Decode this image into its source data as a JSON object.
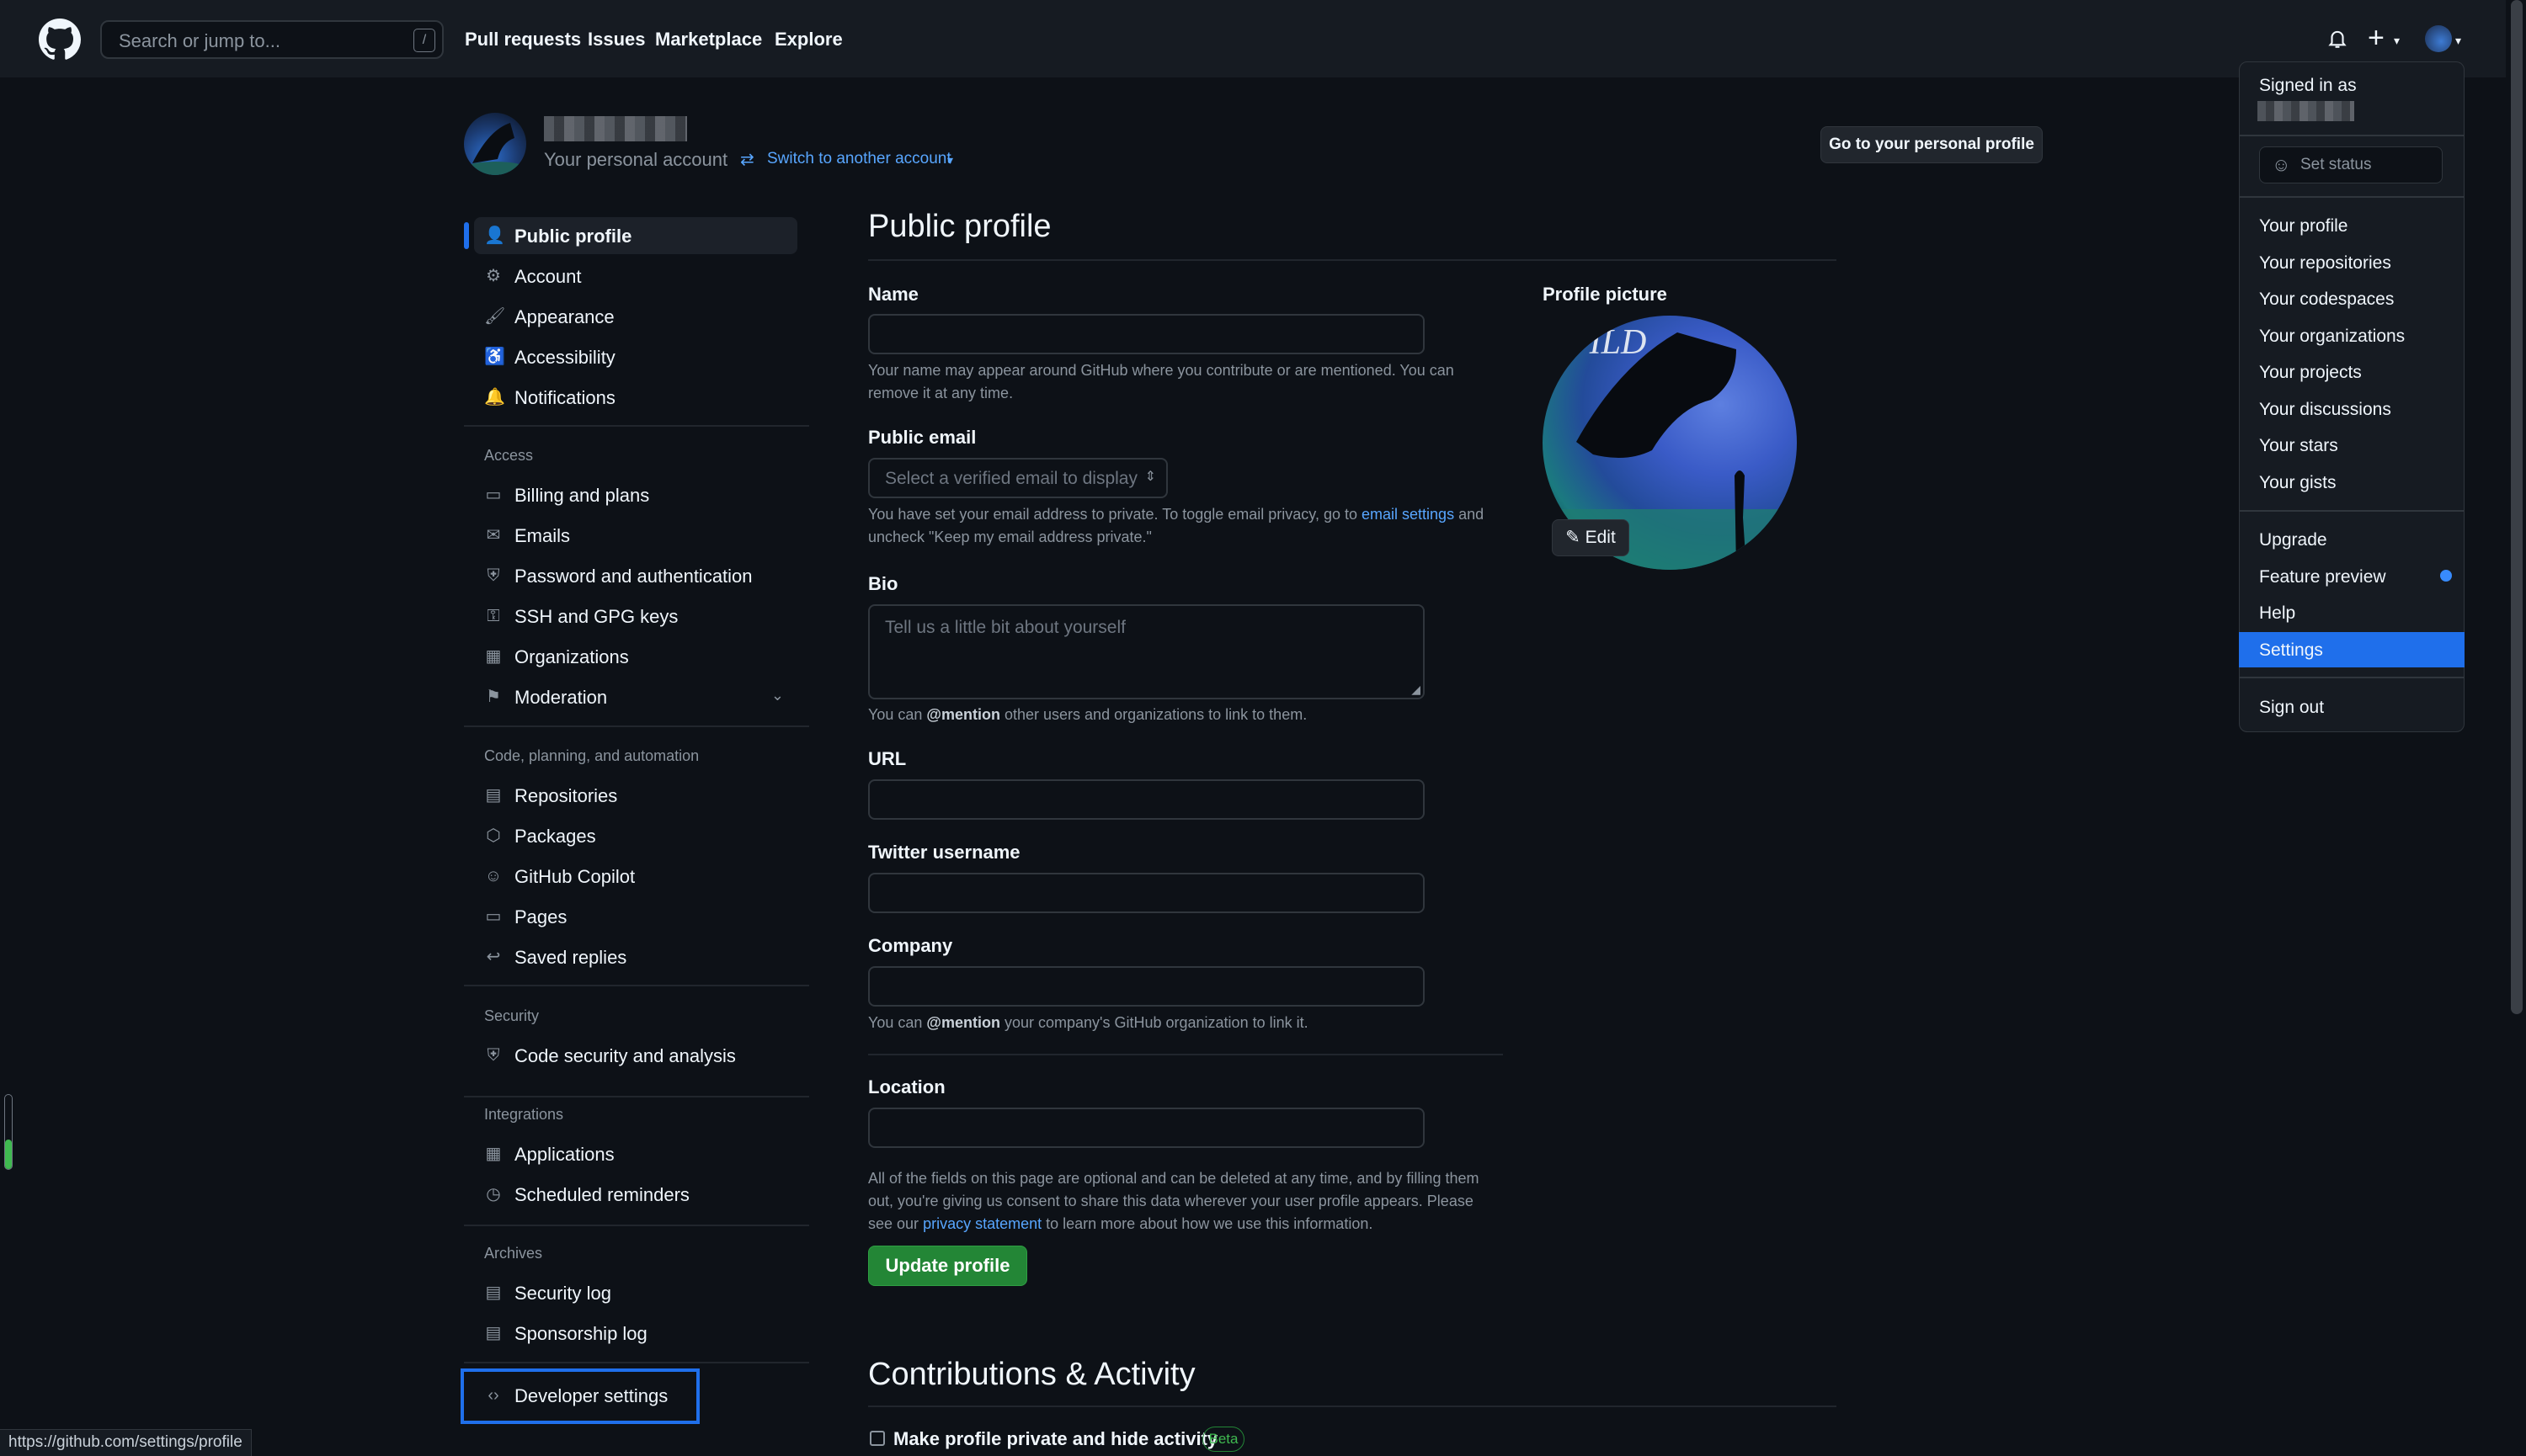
{
  "header": {
    "search_placeholder": "Search or jump to...",
    "search_shortcut": "/",
    "nav": [
      "Pull requests",
      "Issues",
      "Marketplace",
      "Explore"
    ]
  },
  "account": {
    "subtitle": "Your personal account",
    "switch_label": "Switch to another account",
    "go_profile_button": "Go to your personal profile"
  },
  "sidebar": {
    "top": [
      {
        "label": "Public profile",
        "icon": "person-icon",
        "active": true
      },
      {
        "label": "Account",
        "icon": "gear-icon"
      },
      {
        "label": "Appearance",
        "icon": "paintbrush-icon"
      },
      {
        "label": "Accessibility",
        "icon": "accessibility-icon"
      },
      {
        "label": "Notifications",
        "icon": "bell-icon"
      }
    ],
    "access_heading": "Access",
    "access": [
      {
        "label": "Billing and plans",
        "icon": "credit-card-icon"
      },
      {
        "label": "Emails",
        "icon": "mail-icon"
      },
      {
        "label": "Password and authentication",
        "icon": "shield-lock-icon"
      },
      {
        "label": "SSH and GPG keys",
        "icon": "key-icon"
      },
      {
        "label": "Organizations",
        "icon": "organization-icon"
      },
      {
        "label": "Moderation",
        "icon": "report-icon"
      }
    ],
    "code_heading": "Code, planning, and automation",
    "code": [
      {
        "label": "Repositories",
        "icon": "repo-icon"
      },
      {
        "label": "Packages",
        "icon": "package-icon"
      },
      {
        "label": "GitHub Copilot",
        "icon": "copilot-icon"
      },
      {
        "label": "Pages",
        "icon": "browser-icon"
      },
      {
        "label": "Saved replies",
        "icon": "reply-icon"
      }
    ],
    "security_heading": "Security",
    "security": [
      {
        "label": "Code security and analysis",
        "icon": "shield-icon"
      }
    ],
    "integrations_heading": "Integrations",
    "integrations": [
      {
        "label": "Applications",
        "icon": "apps-icon"
      },
      {
        "label": "Scheduled reminders",
        "icon": "clock-icon"
      }
    ],
    "archives_heading": "Archives",
    "archives": [
      {
        "label": "Security log",
        "icon": "log-icon"
      },
      {
        "label": "Sponsorship log",
        "icon": "log-icon"
      }
    ],
    "developer": {
      "label": "Developer settings",
      "icon": "code-icon"
    }
  },
  "main": {
    "title": "Public profile",
    "name_label": "Name",
    "name_note": "Your name may appear around GitHub where you contribute or are mentioned. You can remove it at any time.",
    "email_label": "Public email",
    "email_placeholder": "Select a verified email to display",
    "email_note_1": "You have set your email address to private. To toggle email privacy, go to",
    "email_note_link": "email settings",
    "email_note_2": "and uncheck \"Keep my email address private.\"",
    "bio_label": "Bio",
    "bio_placeholder": "Tell us a little bit about yourself",
    "bio_note_1": "You can",
    "bio_note_mention": "@mention",
    "bio_note_2": "other users and organizations to link to them.",
    "url_label": "URL",
    "twitter_label": "Twitter username",
    "company_label": "Company",
    "company_note_1": "You can",
    "company_note_mention": "@mention",
    "company_note_2": "your company's GitHub organization to link it.",
    "location_label": "Location",
    "footer_note_1": "All of the fields on this page are optional and can be deleted at any time, and by filling them out, you're giving us consent to share this data wherever your user profile appears. Please see our",
    "footer_note_link": "privacy statement",
    "footer_note_2": "to learn more about how we use this information.",
    "update_button": "Update profile",
    "profile_picture_label": "Profile picture",
    "edit_button": "Edit",
    "contributions_title": "Contributions & Activity",
    "private_label": "Make profile private and hide activity",
    "beta_badge": "Beta"
  },
  "dropdown": {
    "signed_in_as": "Signed in as",
    "set_status": "Set status",
    "group1": [
      "Your profile",
      "Your repositories",
      "Your codespaces",
      "Your organizations",
      "Your projects",
      "Your discussions",
      "Your stars",
      "Your gists"
    ],
    "group2": [
      "Upgrade",
      "Feature preview",
      "Help",
      "Settings"
    ],
    "active_item": "Settings",
    "sign_out": "Sign out"
  },
  "statusbar": {
    "url": "https://github.com/settings/profile"
  },
  "colors": {
    "accent": "#1f6feb",
    "success": "#238636",
    "bg": "#0d1117",
    "link": "#58a6ff"
  }
}
